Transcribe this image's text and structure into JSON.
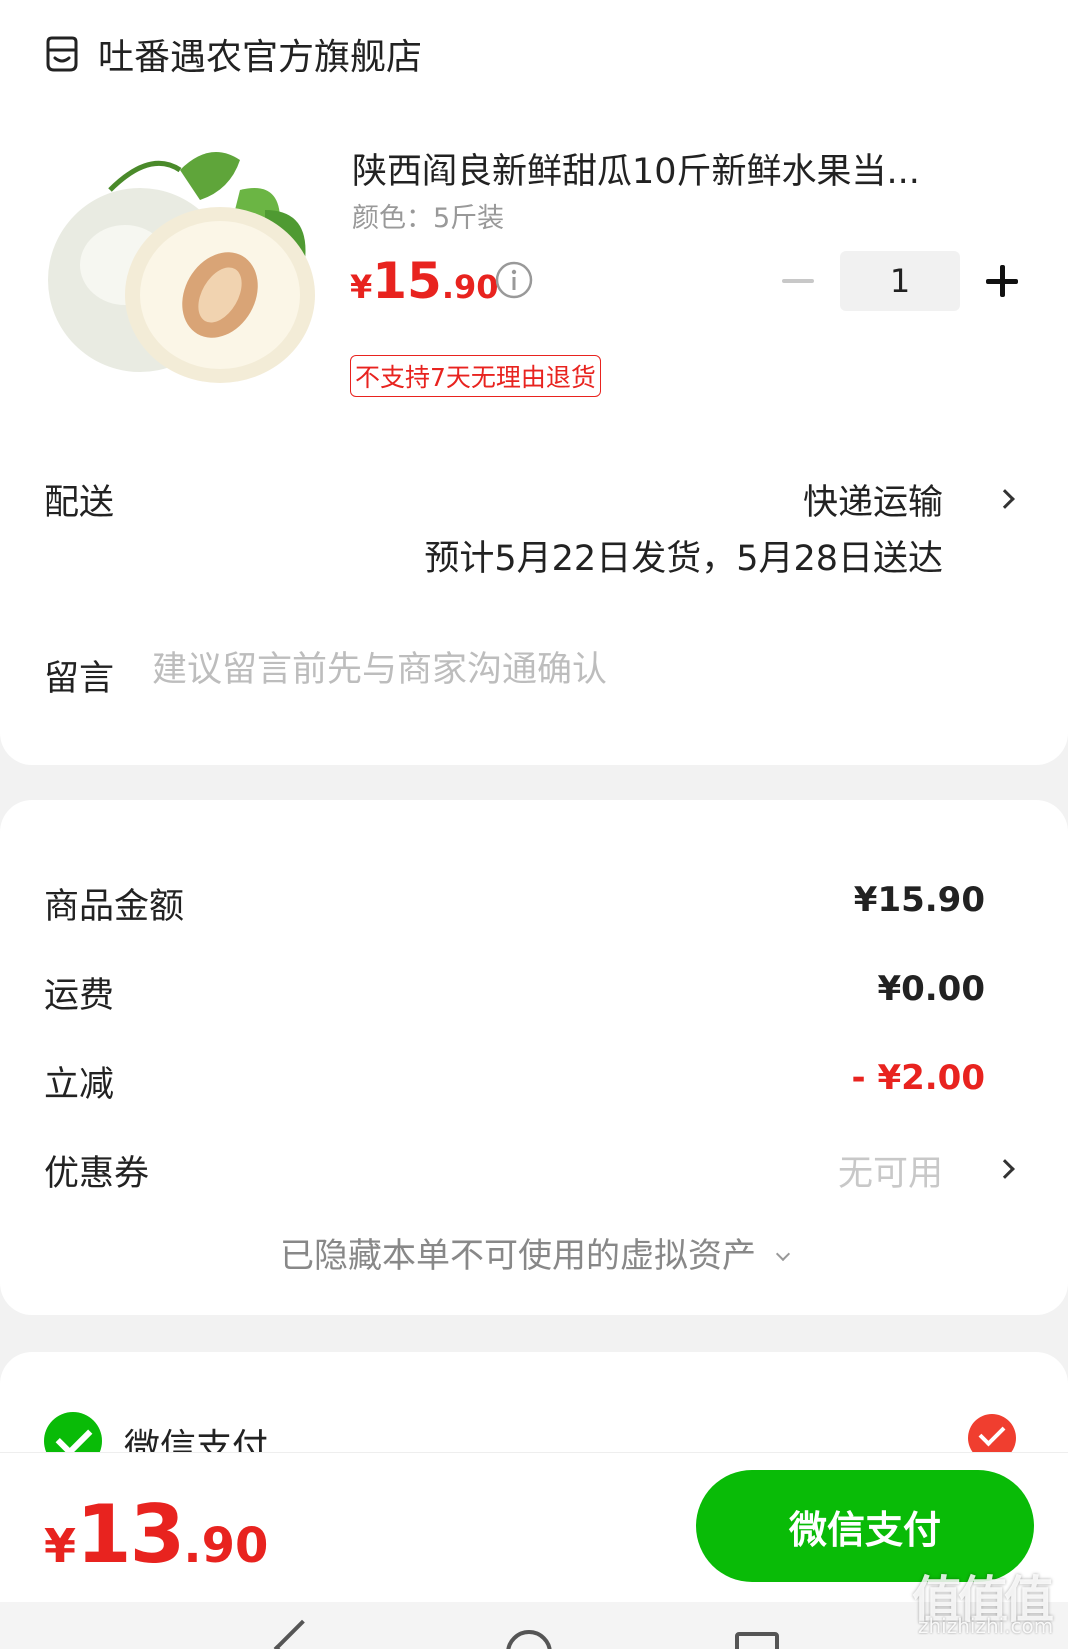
{
  "shop": {
    "name": "吐番遇农官方旗舰店"
  },
  "product": {
    "title": "陕西阎良新鲜甜瓜10斤新鲜水果当...",
    "spec": "颜色：5斤装",
    "price_symbol": "¥",
    "price_int": "15",
    "price_dec": ".90",
    "quantity": "1",
    "badge": "不支持7天无理由退货"
  },
  "delivery": {
    "label": "配送",
    "method": "快递运输",
    "eta": "预计5月22日发货，5月28日送达"
  },
  "memo": {
    "label": "留言",
    "placeholder": "建议留言前先与商家沟通确认"
  },
  "summary": {
    "goods_label": "商品金额",
    "goods_value": "¥15.90",
    "shipping_label": "运费",
    "shipping_value": "¥0.00",
    "discount_label": "立减",
    "discount_value": "- ¥2.00",
    "coupon_label": "优惠券",
    "coupon_value": "无可用",
    "hidden_assets": "已隐藏本单不可使用的虚拟资产"
  },
  "payment": {
    "method_label": "微信支付"
  },
  "checkout": {
    "total_symbol": "¥",
    "total_int": "13",
    "total_dec": ".90",
    "pay_button": "微信支付"
  },
  "watermark": {
    "text": "值值值",
    "sub": "zhizhizhi.com"
  },
  "colors": {
    "accent_red": "#e8231f",
    "wechat_green": "#09bb07"
  }
}
